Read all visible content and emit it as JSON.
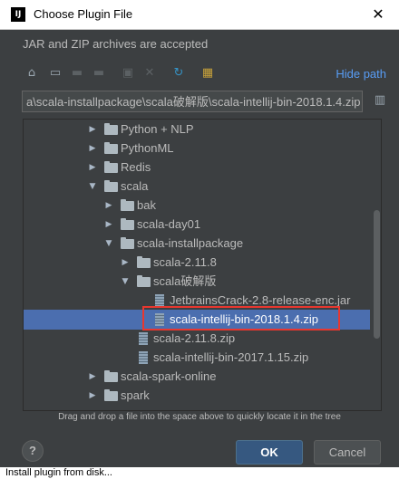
{
  "window": {
    "title": "Choose Plugin File",
    "app_icon": "IJ",
    "close_glyph": "✕"
  },
  "subtitle": "JAR and ZIP archives are accepted",
  "toolbar": {
    "icons": [
      "home-icon",
      "desktop-icon",
      "project-folder-icon",
      "module-folder-icon",
      "new-folder-icon",
      "delete-icon",
      "refresh-icon",
      "show-hidden-icon"
    ],
    "hide_path_label": "Hide path"
  },
  "path": {
    "value": "a\\scala-installpackage\\scala破解版\\scala-intellij-bin-2018.1.4.zip"
  },
  "tree": {
    "items": [
      {
        "label": "Python + NLP",
        "type": "folder",
        "expanded": false
      },
      {
        "label": "PythonML",
        "type": "folder",
        "expanded": false
      },
      {
        "label": "Redis",
        "type": "folder",
        "expanded": false
      },
      {
        "label": "scala",
        "type": "folder",
        "expanded": true
      },
      {
        "label": "bak",
        "type": "folder",
        "expanded": false
      },
      {
        "label": "scala-day01",
        "type": "folder",
        "expanded": false
      },
      {
        "label": "scala-installpackage",
        "type": "folder",
        "expanded": true
      },
      {
        "label": "scala-2.11.8",
        "type": "folder",
        "expanded": false
      },
      {
        "label": "scala破解版",
        "type": "folder",
        "expanded": true
      },
      {
        "label": "JetbrainsCrack-2.8-release-enc.jar",
        "type": "file"
      },
      {
        "label": "scala-intellij-bin-2018.1.4.zip",
        "type": "file",
        "selected": true
      },
      {
        "label": "scala-2.11.8.zip",
        "type": "file"
      },
      {
        "label": "scala-intellij-bin-2017.1.15.zip",
        "type": "file"
      },
      {
        "label": "scala-spark-online",
        "type": "folder",
        "expanded": false
      },
      {
        "label": "spark",
        "type": "folder",
        "expanded": false
      }
    ]
  },
  "hint": "Drag and drop a file into the space above to quickly locate it in the tree",
  "buttons": {
    "help": "?",
    "ok": "OK",
    "cancel": "Cancel"
  },
  "background_text": "Install plugin from disk...",
  "colors": {
    "background": "#3c3f41",
    "selection": "#4b6eaf",
    "link": "#589df6",
    "highlight_box": "#e8372f",
    "ok_button": "#365880"
  }
}
